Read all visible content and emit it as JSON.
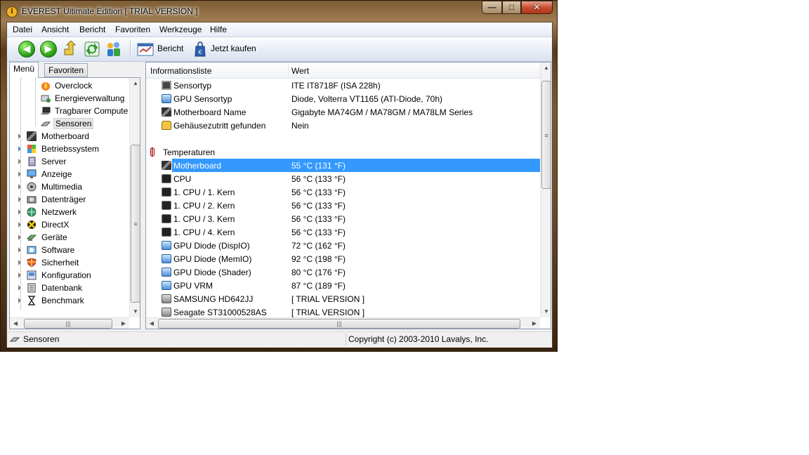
{
  "window": {
    "title": "EVEREST Ultimate Edition  [ TRIAL VERSION ]",
    "app_icon_glyph": "i",
    "minimize": "—",
    "maximize": "□",
    "close": "✕"
  },
  "menu": [
    "Datei",
    "Ansicht",
    "Bericht",
    "Favoriten",
    "Werkzeuge",
    "Hilfe"
  ],
  "toolbar": {
    "report_label": "Bericht",
    "buy_label": "Jetzt kaufen",
    "icons": [
      "back-icon",
      "forward-icon",
      "up-icon",
      "refresh-icon",
      "users-icon",
      "report-icon",
      "buy-icon"
    ]
  },
  "tabs": {
    "menu": "Menü",
    "favorites": "Favoriten"
  },
  "tree": {
    "children": [
      {
        "label": "Overclock",
        "icon": "flame-icon"
      },
      {
        "label": "Energieverwaltung",
        "icon": "power-icon"
      },
      {
        "label": "Tragbarer Compute",
        "icon": "laptop-icon"
      },
      {
        "label": "Sensoren",
        "icon": "sensor-icon",
        "selected": true
      }
    ],
    "items": [
      {
        "label": "Motherboard",
        "icon": "motherboard-icon"
      },
      {
        "label": "Betriebssystem",
        "icon": "windows-icon"
      },
      {
        "label": "Server",
        "icon": "server-icon"
      },
      {
        "label": "Anzeige",
        "icon": "monitor-icon"
      },
      {
        "label": "Multimedia",
        "icon": "multimedia-icon"
      },
      {
        "label": "Datenträger",
        "icon": "storage-icon"
      },
      {
        "label": "Netzwerk",
        "icon": "network-icon"
      },
      {
        "label": "DirectX",
        "icon": "directx-icon"
      },
      {
        "label": "Geräte",
        "icon": "devices-icon"
      },
      {
        "label": "Software",
        "icon": "software-icon"
      },
      {
        "label": "Sicherheit",
        "icon": "shield-icon"
      },
      {
        "label": "Konfiguration",
        "icon": "config-icon"
      },
      {
        "label": "Datenbank",
        "icon": "database-icon"
      },
      {
        "label": "Benchmark",
        "icon": "hourglass-icon"
      }
    ]
  },
  "list": {
    "col_info": "Informationsliste",
    "col_value": "Wert",
    "rows": [
      {
        "label": "Sensortyp",
        "value": "ITE IT8718F  (ISA 228h)",
        "icon": "chip"
      },
      {
        "label": "GPU Sensortyp",
        "value": "Diode, Volterra VT1165  (ATI-Diode, 70h)",
        "icon": "gpu"
      },
      {
        "label": "Motherboard Name",
        "value": "Gigabyte MA74GM / MA78GM / MA78LM Series",
        "icon": "board"
      },
      {
        "label": "Gehäusezutritt gefunden",
        "value": "Nein",
        "icon": "lock"
      },
      {
        "label": "",
        "value": "",
        "icon": ""
      },
      {
        "label": "Temperaturen",
        "value": "",
        "icon": "therm",
        "group": true
      },
      {
        "label": "Motherboard",
        "value": "55 °C  (131 °F)",
        "icon": "board",
        "selected": true
      },
      {
        "label": "CPU",
        "value": "56 °C  (133 °F)",
        "icon": "cpu"
      },
      {
        "label": "1. CPU / 1. Kern",
        "value": "56 °C  (133 °F)",
        "icon": "cpu"
      },
      {
        "label": "1. CPU / 2. Kern",
        "value": "56 °C  (133 °F)",
        "icon": "cpu"
      },
      {
        "label": "1. CPU / 3. Kern",
        "value": "56 °C  (133 °F)",
        "icon": "cpu"
      },
      {
        "label": "1. CPU / 4. Kern",
        "value": "56 °C  (133 °F)",
        "icon": "cpu"
      },
      {
        "label": "GPU Diode (DispIO)",
        "value": "72 °C  (162 °F)",
        "icon": "gpu"
      },
      {
        "label": "GPU Diode (MemIO)",
        "value": "92 °C  (198 °F)",
        "icon": "gpu"
      },
      {
        "label": "GPU Diode (Shader)",
        "value": "80 °C  (176 °F)",
        "icon": "gpu"
      },
      {
        "label": "GPU VRM",
        "value": "87 °C  (189 °F)",
        "icon": "gpu"
      },
      {
        "label": "SAMSUNG HD642JJ",
        "value": "[ TRIAL VERSION ]",
        "icon": "hdd"
      },
      {
        "label": "Seagate ST31000528AS",
        "value": "[ TRIAL VERSION ]",
        "icon": "hdd"
      }
    ]
  },
  "statusbar": {
    "left": "Sensoren",
    "right": "Copyright (c) 2003-2010 Lavalys, Inc."
  },
  "colors": {
    "selection": "#3399ff",
    "frame": "#6a4a28"
  }
}
